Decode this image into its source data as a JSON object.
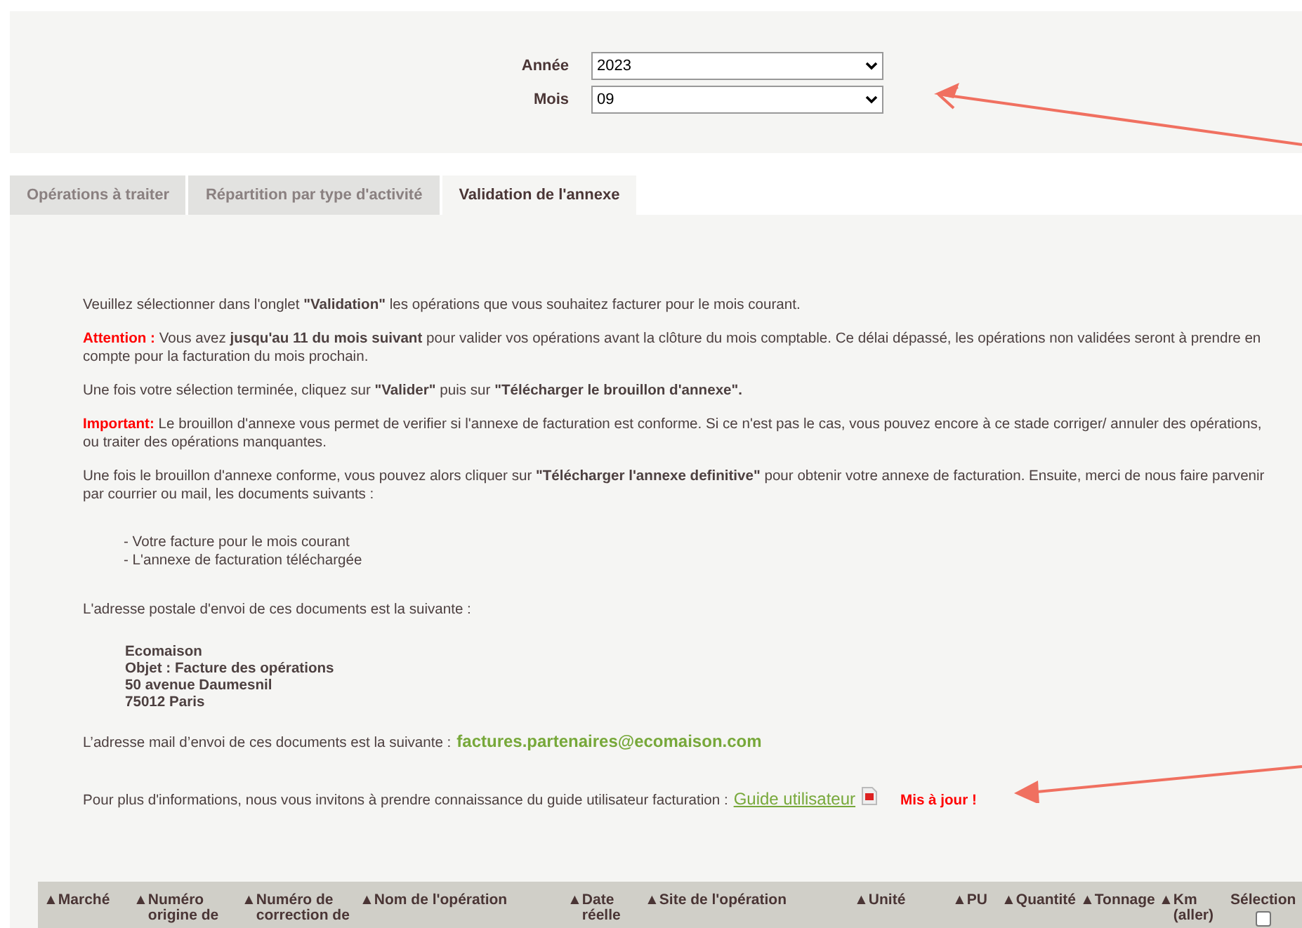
{
  "filters": [
    {
      "label": "Année",
      "value": "2023"
    },
    {
      "label": "Mois",
      "value": "09"
    }
  ],
  "tabs": [
    {
      "label": "Opérations à traiter",
      "selected": false
    },
    {
      "label": "Répartition par type d'activité",
      "selected": false
    },
    {
      "label": "Validation de l'annexe",
      "selected": true
    }
  ],
  "paragraphs": [
    {
      "text": "Veuillez sélectionner dans l'onglet **\"Validation\"** les opérations que vous souhaitez facturer pour le mois courant."
    },
    {
      "lead": "Attention :",
      "text": "Vous avez **jusqu'au 11 du mois suivant** pour valider vos opérations avant la clôture du mois comptable. Ce délai dépassé, les opérations non validées seront à prendre en compte pour la facturation du mois prochain."
    },
    {
      "text": "Une fois votre sélection terminée, cliquez sur **\"Valider\"** puis sur **\"Télécharger le brouillon d'annexe\".**"
    },
    {
      "lead": "Important:",
      "text": "Le brouillon d'annexe vous permet de verifier si l'annexe de facturation est conforme. Si ce n'est pas le cas, vous pouvez encore à ce stade corriger/ annuler des opérations, ou traiter des opérations manquantes."
    },
    {
      "text": "Une fois le brouillon d'annexe conforme, vous pouvez alors cliquer sur **\"Télécharger l'annexe definitive\"** pour obtenir votre annexe de facturation. Ensuite, merci de nous faire parvenir par courrier ou mail, les documents suivants :"
    }
  ],
  "documents": [
    "- Votre facture pour le mois courant",
    "- L'annexe de facturation téléchargée"
  ],
  "postal_intro": "L'adresse postale d'envoi de ces documents est la suivante :",
  "address": [
    "Ecomaison",
    "Objet : Facture des opérations",
    "50 avenue Daumesnil",
    "75012 Paris"
  ],
  "mail": {
    "text": "L’adresse mail d’envoi de ces documents est la suivante :",
    "email": "factures.partenaires@ecomaison.com"
  },
  "guide": {
    "text": "Pour plus d'informations, nous vous invitons à prendre connaissance du guide utilisateur facturation :",
    "link": "Guide utilisateur",
    "badge": "Mis à jour !"
  },
  "table": {
    "columns": [
      {
        "sort": "▲",
        "label": "Marché"
      },
      {
        "sort": "▲",
        "label": "Numéro origine de"
      },
      {
        "sort": "▲",
        "label": "Numéro de correction de"
      },
      {
        "sort": "▲",
        "label": "Nom de l'opération"
      },
      {
        "sort": "▲",
        "label": "Date réelle"
      },
      {
        "sort": "▲",
        "label": "Site de l'opération"
      },
      {
        "sort": "▲",
        "label": "Unité"
      },
      {
        "sort": "▲",
        "label": "PU"
      },
      {
        "sort": "▲",
        "label": "Quantité"
      },
      {
        "sort": "▲",
        "label": "Tonnage"
      },
      {
        "sort": "▲",
        "label": "Km (aller)"
      }
    ],
    "select_all": {
      "label": "Sélection",
      "checked": false
    }
  }
}
